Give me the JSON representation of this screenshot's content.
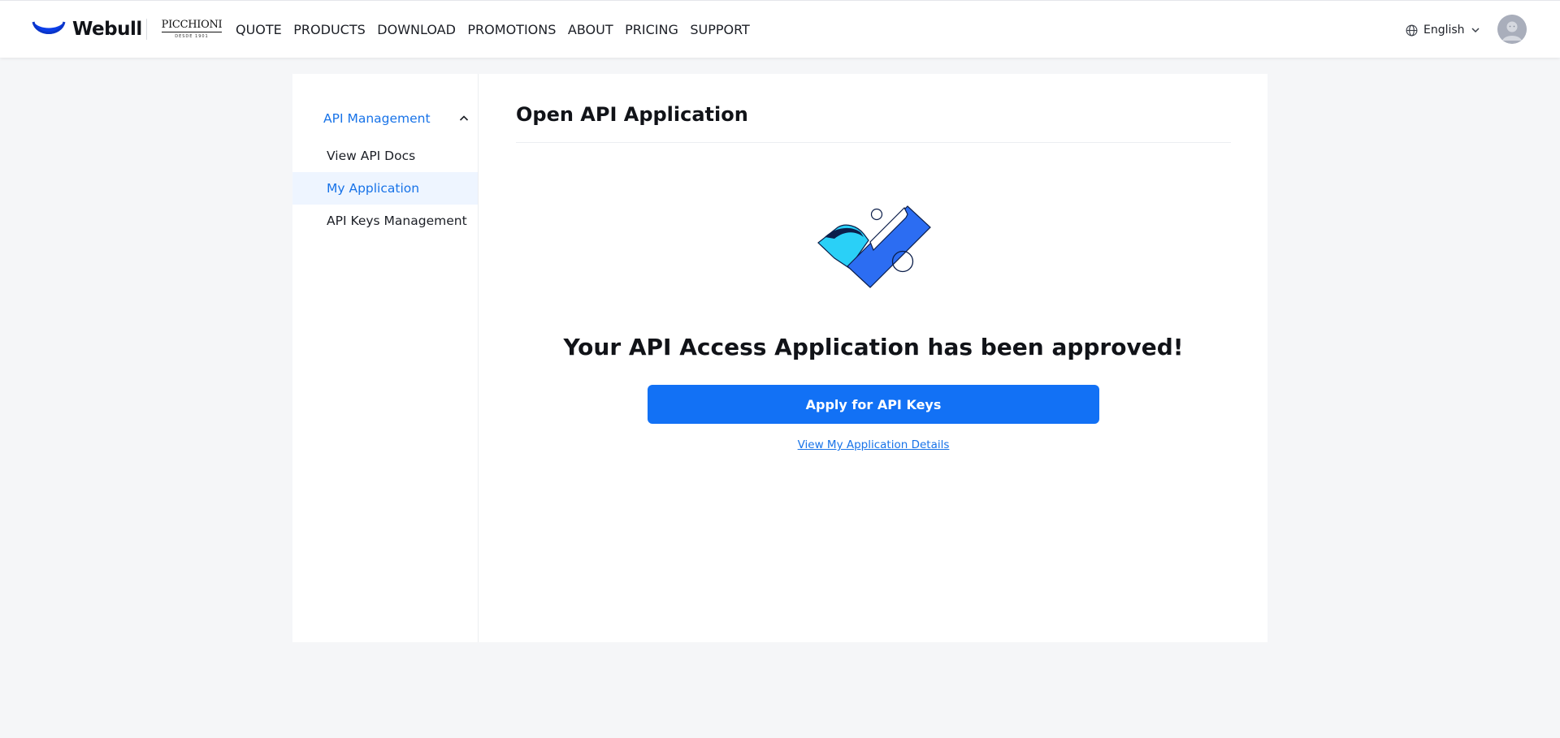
{
  "header": {
    "logo_text": "Webull",
    "partner": {
      "name": "PICCHIONI",
      "subtitle": "DESDE 1901"
    },
    "nav": [
      "QUOTE",
      "PRODUCTS",
      "DOWNLOAD",
      "PROMOTIONS",
      "ABOUT",
      "PRICING",
      "SUPPORT"
    ],
    "language": "English",
    "icons": {
      "language": "globe-icon",
      "dropdown": "chevron-down-icon",
      "avatar": "user-avatar"
    }
  },
  "sidebar": {
    "group_label": "API Management",
    "group_expanded": true,
    "items": [
      {
        "label": "View API Docs",
        "active": false
      },
      {
        "label": "My Application",
        "active": true
      },
      {
        "label": "API Keys Management",
        "active": false
      }
    ]
  },
  "main": {
    "title": "Open API Application",
    "illustration": "approved-checkmark-illustration",
    "headline": "Your API Access Application has been approved!",
    "primary_button": "Apply for API Keys",
    "details_link": "View My Application Details"
  },
  "colors": {
    "brand_blue": "#1271f5",
    "link_blue": "#1873e8",
    "active_bg": "#eef5ff",
    "page_bg": "#f5f6f8",
    "text": "#1c1f26"
  }
}
